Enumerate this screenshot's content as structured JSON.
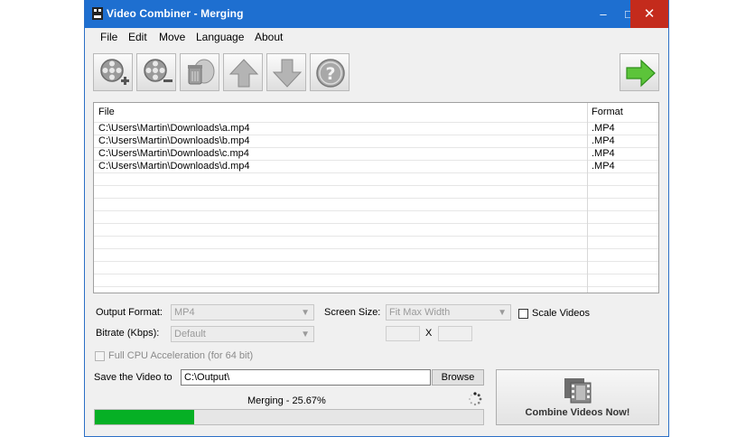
{
  "window": {
    "title": "Video Combiner - Merging"
  },
  "menu": [
    "File",
    "Edit",
    "Move",
    "Language",
    "About"
  ],
  "toolbar": {
    "buttons": [
      {
        "name": "add-video-button",
        "icon": "film-reel-add-icon"
      },
      {
        "name": "remove-video-button",
        "icon": "film-reel-remove-icon"
      },
      {
        "name": "clear-list-button",
        "icon": "trash-icon"
      },
      {
        "name": "move-up-button",
        "icon": "arrow-up-icon"
      },
      {
        "name": "move-down-button",
        "icon": "arrow-down-icon"
      },
      {
        "name": "help-button",
        "icon": "help-icon"
      }
    ],
    "start": {
      "name": "start-button",
      "icon": "arrow-right-icon"
    }
  },
  "files": {
    "columns": {
      "file": "File",
      "format": "Format"
    },
    "rows": [
      {
        "file": "C:\\Users\\Martin\\Downloads\\a.mp4",
        "format": ".MP4"
      },
      {
        "file": "C:\\Users\\Martin\\Downloads\\b.mp4",
        "format": ".MP4"
      },
      {
        "file": "C:\\Users\\Martin\\Downloads\\c.mp4",
        "format": ".MP4"
      },
      {
        "file": "C:\\Users\\Martin\\Downloads\\d.mp4",
        "format": ".MP4"
      }
    ]
  },
  "settings": {
    "output_format_label": "Output Format:",
    "output_format_value": "MP4",
    "screen_size_label": "Screen Size:",
    "screen_size_value": "Fit Max Width",
    "scale_videos_label": "Scale Videos",
    "bitrate_label": "Bitrate (Kbps):",
    "bitrate_value": "Default",
    "dim_separator": "X",
    "cpu_label": "Full CPU Acceleration (for 64 bit)"
  },
  "save": {
    "label": "Save the Video to",
    "path": "C:\\Output\\",
    "browse": "Browse"
  },
  "status": {
    "text": "Merging - 25.67%",
    "progress": 0.2567
  },
  "combine_label": "Combine Videos Now!",
  "colors": {
    "titlebar": "#1e6fd0",
    "progress": "#06b025",
    "close": "#c42b1c"
  }
}
